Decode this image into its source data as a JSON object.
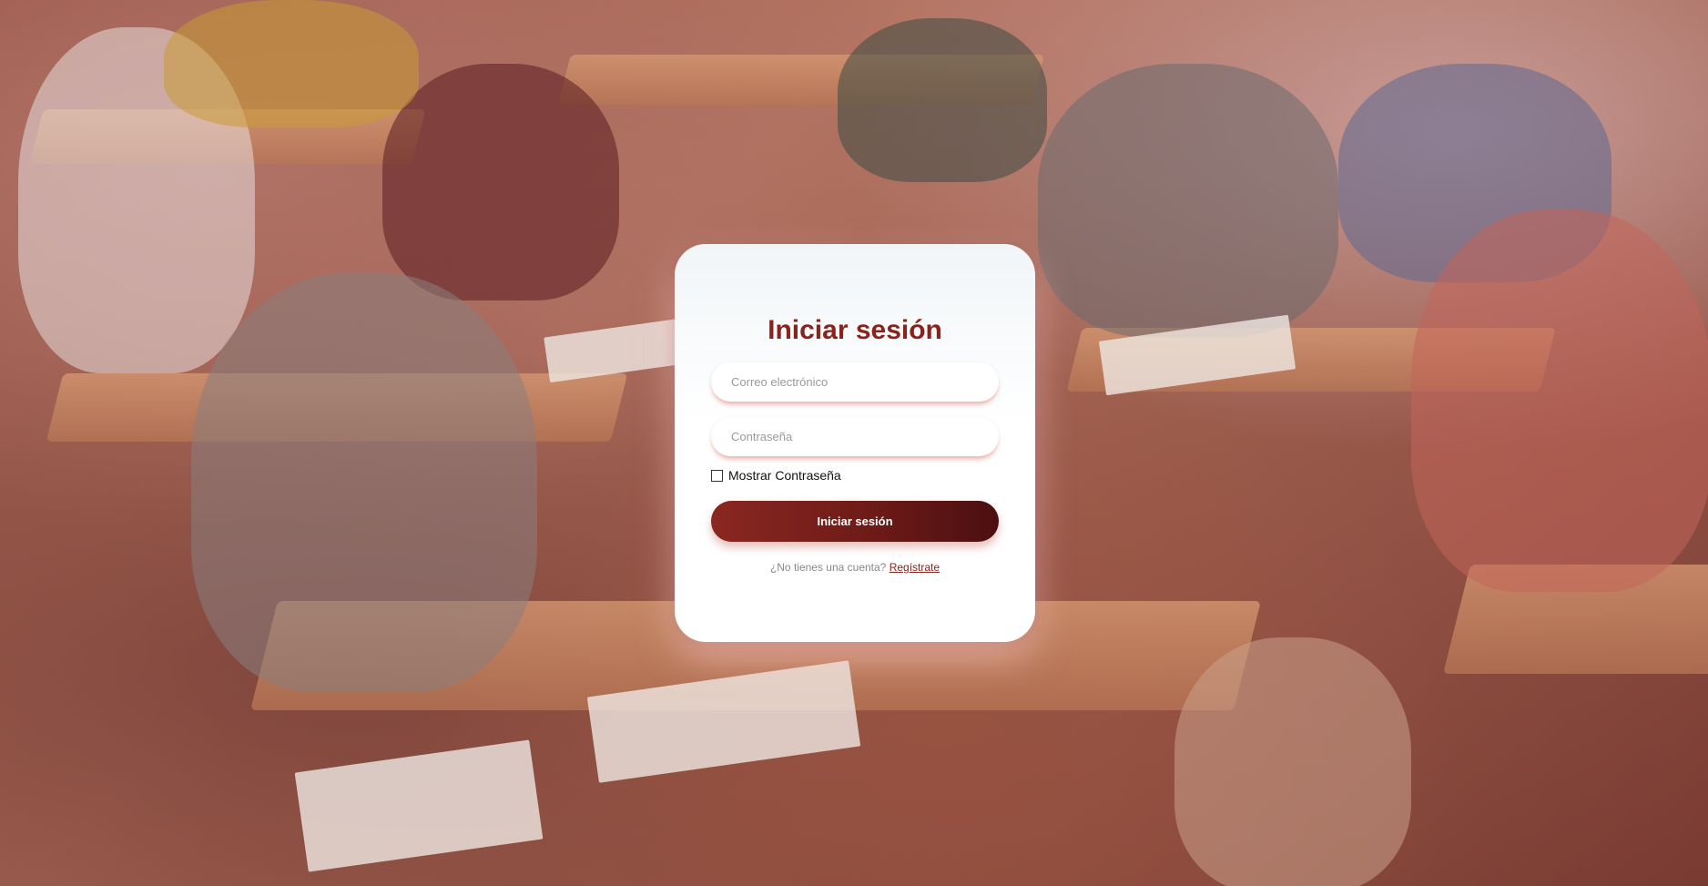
{
  "login": {
    "title": "Iniciar sesión",
    "email_placeholder": "Correo electrónico",
    "email_value": "",
    "password_placeholder": "Contraseña",
    "password_value": "",
    "show_password_label": "Mostrar Contraseña",
    "show_password_checked": false,
    "submit_label": "Iniciar sesión",
    "register_prompt": "¿No tienes una cuenta?",
    "register_link": "Regístrate"
  },
  "colors": {
    "accent": "#8a231d",
    "button_gradient_start": "#8a2720",
    "button_gradient_end": "#4b0f10",
    "card_background": "#ffffff"
  }
}
